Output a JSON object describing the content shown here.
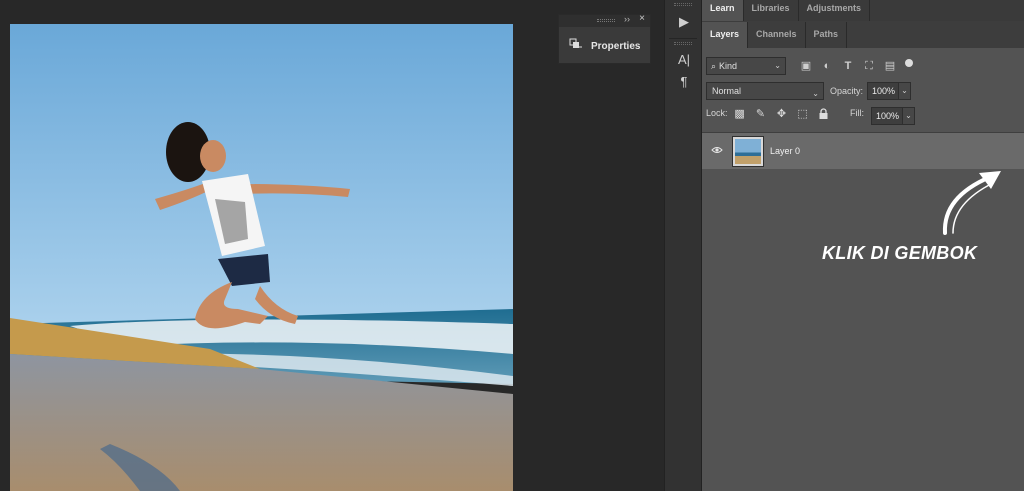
{
  "properties_panel": {
    "title": "Properties",
    "collapse_glyph": "››",
    "close_glyph": "×"
  },
  "toolbar": {
    "play_glyph": "▶",
    "char_glyph": "A|",
    "para_glyph": "¶"
  },
  "top_tabs": [
    {
      "label": "Learn",
      "active": true
    },
    {
      "label": "Libraries",
      "active": false
    },
    {
      "label": "Adjustments",
      "active": false
    }
  ],
  "panel_tabs": [
    {
      "label": "Layers",
      "active": true
    },
    {
      "label": "Channels",
      "active": false
    },
    {
      "label": "Paths",
      "active": false
    }
  ],
  "filter": {
    "kind_label": "Kind"
  },
  "blend": {
    "mode": "Normal",
    "opacity_label": "Opacity:",
    "opacity_value": "100%"
  },
  "lock": {
    "label": "Lock:",
    "fill_label": "Fill:",
    "fill_value": "100%"
  },
  "layers": [
    {
      "name": "Layer 0",
      "visible": true
    }
  ],
  "annotation": {
    "text": "KLIK DI GEMBOK"
  },
  "colors": {
    "panel_bg": "#535353",
    "app_bg": "#282828",
    "selected_layer": "#6a6a6a"
  }
}
